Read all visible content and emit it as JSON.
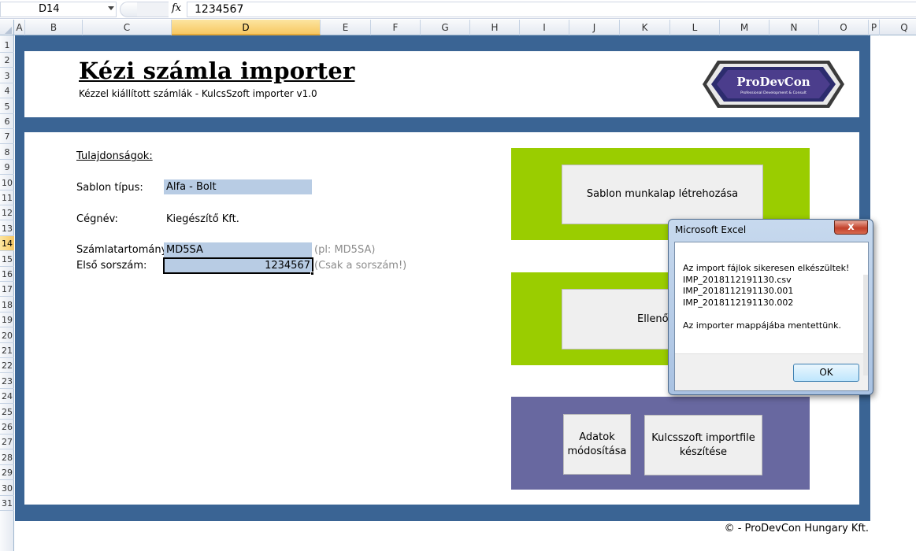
{
  "formula_bar": {
    "cell_ref": "D14",
    "fx": "fx",
    "value": "1234567"
  },
  "columns": [
    {
      "label": "A",
      "selected": false
    },
    {
      "label": "B",
      "selected": false
    },
    {
      "label": "C",
      "selected": false
    },
    {
      "label": "D",
      "selected": true
    },
    {
      "label": "E",
      "selected": false
    },
    {
      "label": "F",
      "selected": false
    },
    {
      "label": "G",
      "selected": false
    },
    {
      "label": "H",
      "selected": false
    },
    {
      "label": "I",
      "selected": false
    },
    {
      "label": "J",
      "selected": false
    },
    {
      "label": "K",
      "selected": false
    },
    {
      "label": "L",
      "selected": false
    },
    {
      "label": "M",
      "selected": false
    },
    {
      "label": "N",
      "selected": false
    },
    {
      "label": "O",
      "selected": false
    },
    {
      "label": "P",
      "selected": false
    },
    {
      "label": "Q",
      "selected": false
    }
  ],
  "rows": [
    "1",
    "2",
    "3",
    "4",
    "5",
    "6",
    "7",
    "8",
    "9",
    "10",
    "11",
    "12",
    "13",
    "14",
    "15",
    "16",
    "17",
    "18",
    "19",
    "20",
    "21",
    "22",
    "23",
    "24",
    "25",
    "26",
    "27",
    "28",
    "29",
    "30",
    "31"
  ],
  "selected_row": "14",
  "header": {
    "title": "Kézi számla importer",
    "subtitle": "Kézzel kiállított számlák - KulcsSzoft importer v1.0",
    "logo_text": "ProDevCon",
    "logo_tagline": "Professional Development & Consult"
  },
  "form": {
    "section_label": "Tulajdonságok:",
    "template_label": "Sablon típus:",
    "template_value": "Alfa - Bolt",
    "company_label": "Cégnév:",
    "company_value": "Kiegészítő Kft.",
    "range_label": "Számlatartomány:",
    "range_value": "MD5SA",
    "range_hint": "(pl: MD5SA)",
    "first_label": "Első sorszám:",
    "first_value": "1234567",
    "first_hint": "(Csak a sorszám!)"
  },
  "buttons": {
    "create_template": "Sablon munkalap létrehozása",
    "check": "Ellenő",
    "edit_data_line1": "Adatok",
    "edit_data_line2": "módosítása",
    "make_import_line1": "Kulcsszoft importfile",
    "make_import_line2": "készítése"
  },
  "footer": "© - ProDevCon Hungary Kft.",
  "dialog": {
    "title": "Microsoft Excel",
    "close": "x",
    "message": "Az import fájlok sikeresen elkészültek!\nIMP_2018112191130.csv\nIMP_2018112191130.001\nIMP_2018112191130.002\n\nAz importer mappájába mentettünk.",
    "ok": "OK"
  },
  "colors": {
    "frame": "#3a6494",
    "green": "#9acd00",
    "purple": "#6868a0",
    "field": "#b8cce4"
  }
}
